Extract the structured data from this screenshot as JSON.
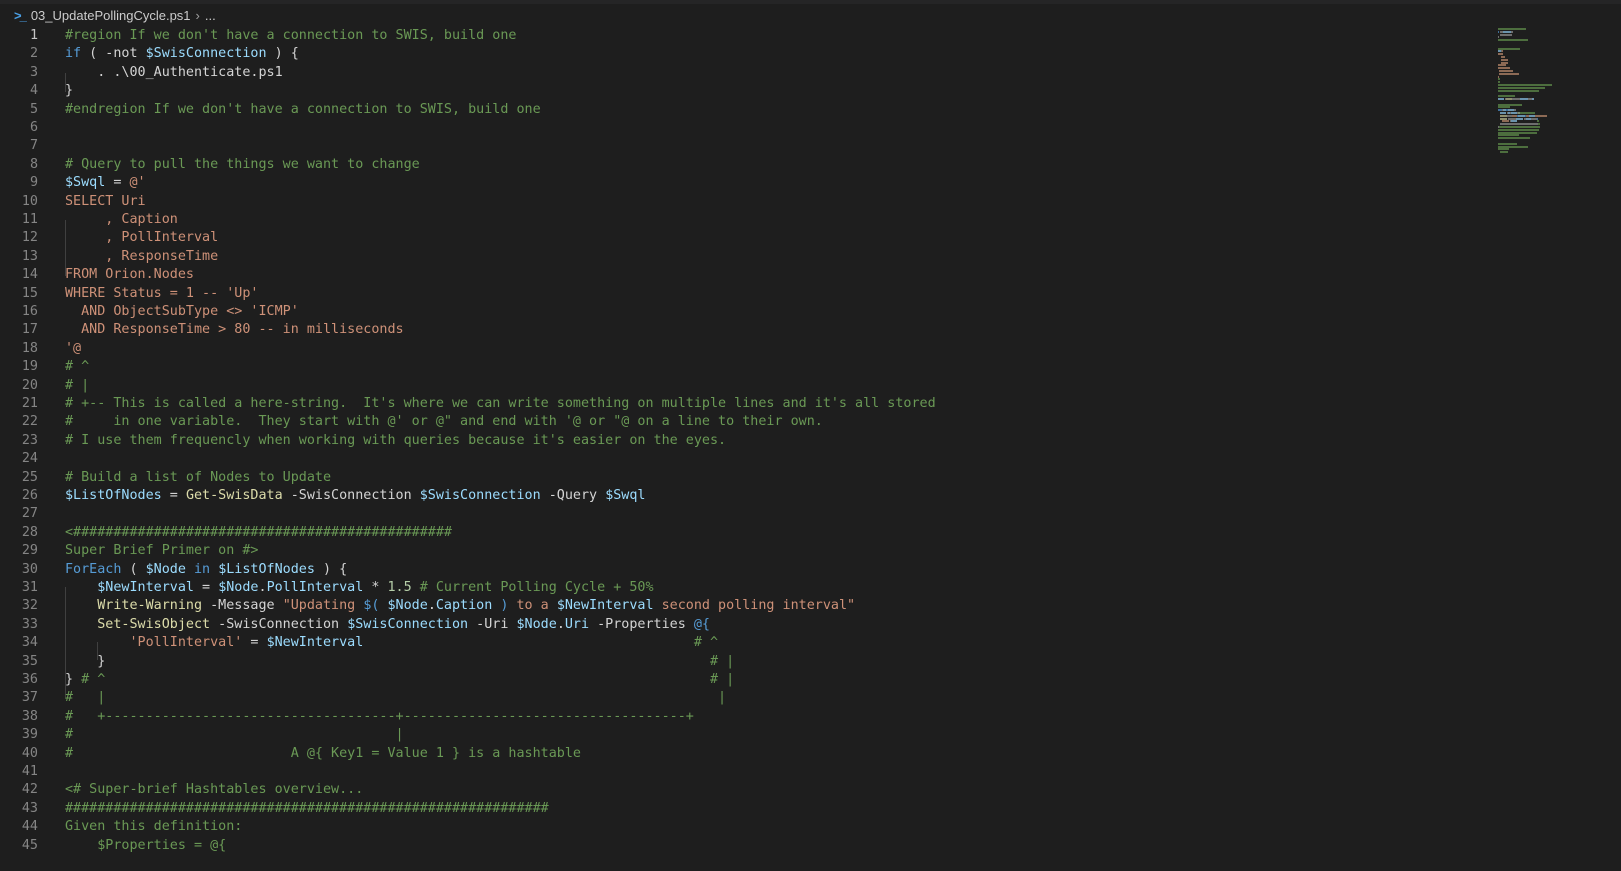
{
  "breadcrumb": {
    "file": "03_UpdatePollingCycle.ps1",
    "more": "..."
  },
  "active_line": 1,
  "lines": [
    [
      [
        "c",
        "#region If we don't have a connection to SWIS, build one"
      ]
    ],
    [
      [
        "k",
        "if"
      ],
      [
        "p",
        " ( -not "
      ],
      [
        "v",
        "$SwisConnection"
      ],
      [
        "p",
        " ) {"
      ]
    ],
    [
      [
        "p",
        "    . .\\00_Authenticate.ps1"
      ]
    ],
    [
      [
        "p",
        "}"
      ]
    ],
    [
      [
        "c",
        "#endregion If we don't have a connection to SWIS, build one"
      ]
    ],
    [],
    [],
    [
      [
        "c",
        "# Query to pull the things we want to change"
      ]
    ],
    [
      [
        "v",
        "$Swql"
      ],
      [
        "p",
        " = "
      ],
      [
        "s",
        "@'"
      ]
    ],
    [
      [
        "s",
        "SELECT Uri"
      ]
    ],
    [
      [
        "s",
        "     , Caption"
      ]
    ],
    [
      [
        "s",
        "     , PollInterval"
      ]
    ],
    [
      [
        "s",
        "     , ResponseTime"
      ]
    ],
    [
      [
        "s",
        "FROM Orion.Nodes"
      ]
    ],
    [
      [
        "s",
        "WHERE Status = 1 -- 'Up'"
      ]
    ],
    [
      [
        "s",
        "  AND ObjectSubType <> 'ICMP'"
      ]
    ],
    [
      [
        "s",
        "  AND ResponseTime > 80 -- in milliseconds"
      ]
    ],
    [
      [
        "s",
        "'@"
      ]
    ],
    [
      [
        "c",
        "# ^"
      ]
    ],
    [
      [
        "c",
        "# |"
      ]
    ],
    [
      [
        "c",
        "# +-- This is called a here-string.  It's where we can write something on multiple lines and it's all stored"
      ]
    ],
    [
      [
        "c",
        "#     in one variable.  They start with @' or @\" and end with '@ or \"@ on a line to their own."
      ]
    ],
    [
      [
        "c",
        "# I use them frequencly when working with queries because it's easier on the eyes."
      ]
    ],
    [],
    [
      [
        "c",
        "# Build a list of Nodes to Update"
      ]
    ],
    [
      [
        "v",
        "$ListOfNodes"
      ],
      [
        "p",
        " = "
      ],
      [
        "f",
        "Get-SwisData"
      ],
      [
        "p",
        " -SwisConnection "
      ],
      [
        "v",
        "$SwisConnection"
      ],
      [
        "p",
        " -Query "
      ],
      [
        "v",
        "$Swql"
      ]
    ],
    [],
    [
      [
        "c",
        "<###############################################"
      ]
    ],
    [
      [
        "c",
        "Super Brief Primer on #>"
      ]
    ],
    [
      [
        "k",
        "ForEach"
      ],
      [
        "p",
        " ( "
      ],
      [
        "v",
        "$Node"
      ],
      [
        "k",
        " in "
      ],
      [
        "v",
        "$ListOfNodes"
      ],
      [
        "p",
        " ) {"
      ]
    ],
    [
      [
        "p",
        "    "
      ],
      [
        "v",
        "$NewInterval"
      ],
      [
        "p",
        " = "
      ],
      [
        "v",
        "$Node"
      ],
      [
        "p",
        "."
      ],
      [
        "v",
        "PollInterval"
      ],
      [
        "p",
        " * "
      ],
      [
        "n",
        "1.5"
      ],
      [
        "c",
        " # Current Polling Cycle + 50%"
      ]
    ],
    [
      [
        "p",
        "    "
      ],
      [
        "f",
        "Write-Warning"
      ],
      [
        "p",
        " -Message "
      ],
      [
        "s",
        "\"Updating "
      ],
      [
        "k",
        "$("
      ],
      [
        "p",
        " "
      ],
      [
        "v",
        "$Node"
      ],
      [
        "p",
        "."
      ],
      [
        "v",
        "Caption"
      ],
      [
        "k",
        " )"
      ],
      [
        "s",
        " to a "
      ],
      [
        "v",
        "$NewInterval"
      ],
      [
        "s",
        " second polling interval\""
      ]
    ],
    [
      [
        "p",
        "    "
      ],
      [
        "f",
        "Set-SwisObject"
      ],
      [
        "p",
        " -SwisConnection "
      ],
      [
        "v",
        "$SwisConnection"
      ],
      [
        "p",
        " -Uri "
      ],
      [
        "v",
        "$Node"
      ],
      [
        "p",
        "."
      ],
      [
        "v",
        "Uri"
      ],
      [
        "p",
        " -Properties "
      ],
      [
        "k",
        "@{"
      ]
    ],
    [
      [
        "p",
        "        "
      ],
      [
        "s",
        "'PollInterval'"
      ],
      [
        "p",
        " = "
      ],
      [
        "v",
        "$NewInterval"
      ],
      [
        "p",
        "                                         "
      ],
      [
        "c",
        "# ^"
      ]
    ],
    [
      [
        "p",
        "    }                                                                           "
      ],
      [
        "c",
        "# |"
      ]
    ],
    [
      [
        "p",
        "} "
      ],
      [
        "c",
        "# ^                                                                           # |"
      ]
    ],
    [
      [
        "c",
        "#   |                                                                            |"
      ]
    ],
    [
      [
        "c",
        "#   +------------------------------------+-----------------------------------+"
      ]
    ],
    [
      [
        "c",
        "#                                        |"
      ]
    ],
    [
      [
        "c",
        "#                           A @{ Key1 = Value 1 } is a hashtable"
      ]
    ],
    [],
    [
      [
        "c",
        "<# Super-brief Hashtables overview..."
      ]
    ],
    [
      [
        "c",
        "############################################################"
      ]
    ],
    [
      [
        "c",
        "Given this definition:"
      ]
    ],
    [
      [
        "c",
        "    $Properties = @{"
      ]
    ]
  ]
}
